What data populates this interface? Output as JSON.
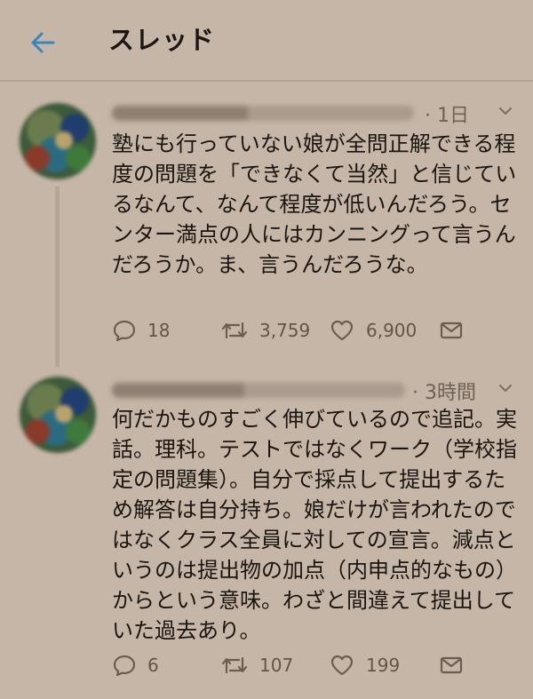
{
  "header": {
    "title": "スレッド"
  },
  "tweets": [
    {
      "time": "· 1日",
      "text": "塾にも行っていない娘が全問正解できる程度の問題を「できなくて当然」と信じているなんて、なんて程度が低いんだろう。センター満点の人にはカンニングって言うんだろうか。ま、言うんだろうな。",
      "replies": "18",
      "retweets": "3,759",
      "likes": "6,900"
    },
    {
      "time": "· 3時間",
      "text": "何だかものすごく伸びているので追記。実話。理科。テストではなくワーク（学校指定の問題集）。自分で採点して提出するため解答は自分持ち。娘だけが言われたのではなくクラス全員に対しての宣言。減点というのは提出物の加点（内申点的なもの）からという意味。わざと間違えて提出していた過去あり。",
      "replies": "6",
      "retweets": "107",
      "likes": "199"
    }
  ],
  "colors": {
    "background": "#c6b6a7",
    "accent": "#3a86b8",
    "text": "#1b1611",
    "muted": "#6e6155"
  },
  "icons": {
    "back": "arrow-left-icon",
    "caret": "chevron-down-icon",
    "reply": "reply-bubble-icon",
    "retweet": "retweet-icon",
    "like": "heart-icon",
    "dm": "envelope-icon"
  }
}
